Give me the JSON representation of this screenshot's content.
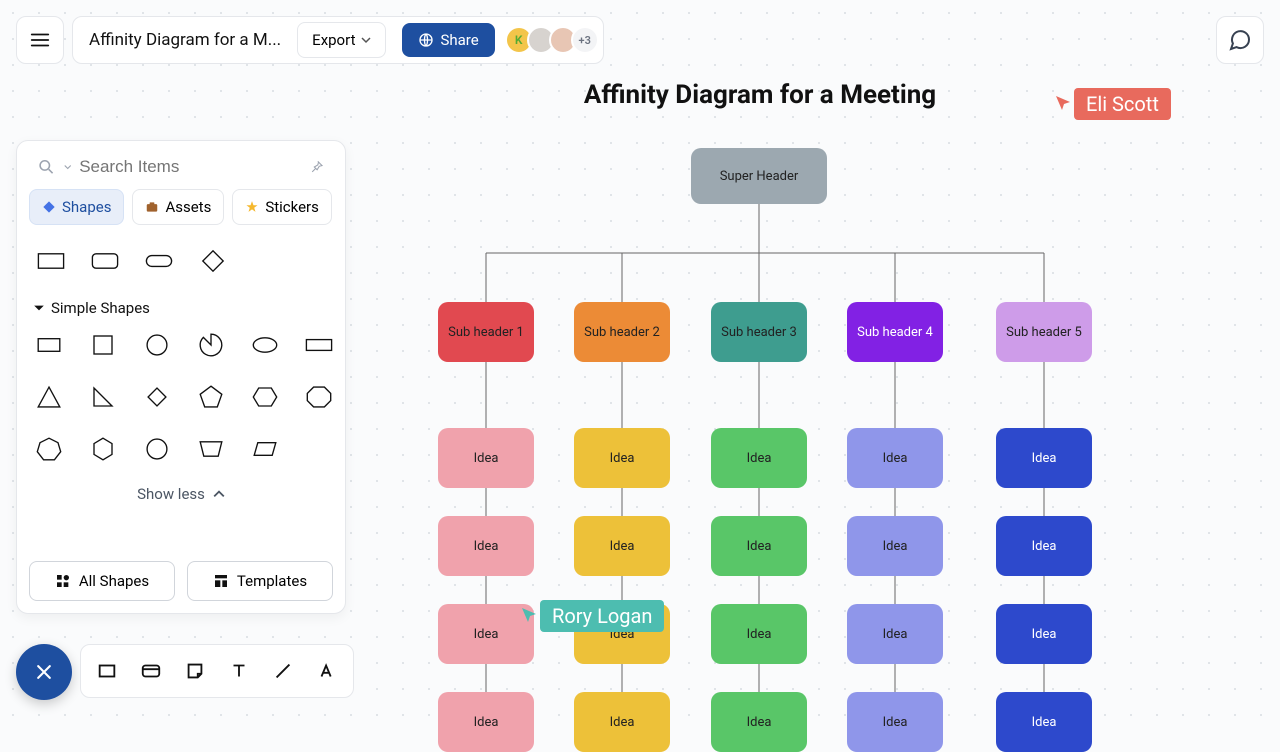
{
  "header": {
    "doc_title": "Affinity Diagram for a M...",
    "export_label": "Export",
    "share_label": "Share",
    "avatar_more": "+3"
  },
  "search": {
    "placeholder": "Search Items"
  },
  "tabs": {
    "shapes": "Shapes",
    "assets": "Assets",
    "stickers": "Stickers"
  },
  "section": {
    "simple_shapes": "Simple Shapes",
    "show_less": "Show less"
  },
  "footer": {
    "all_shapes": "All Shapes",
    "templates": "Templates"
  },
  "canvas": {
    "title": "Affinity Diagram for a Meeting",
    "super_header": "Super Header",
    "subs": [
      "Sub header 1",
      "Sub header 2",
      "Sub header 3",
      "Sub header 4",
      "Sub header 5"
    ],
    "idea": "Idea"
  },
  "cursors": {
    "eli": "Eli Scott",
    "rory": "Rory Logan"
  },
  "colors": {
    "subs": [
      "#e14950",
      "#ec8b36",
      "#3e9d8f",
      "#8221e4",
      "#ce9ce9"
    ],
    "ideas": [
      "#f0a2ac",
      "#edc139",
      "#59c668",
      "#8f96ea",
      "#2d49cc"
    ]
  }
}
